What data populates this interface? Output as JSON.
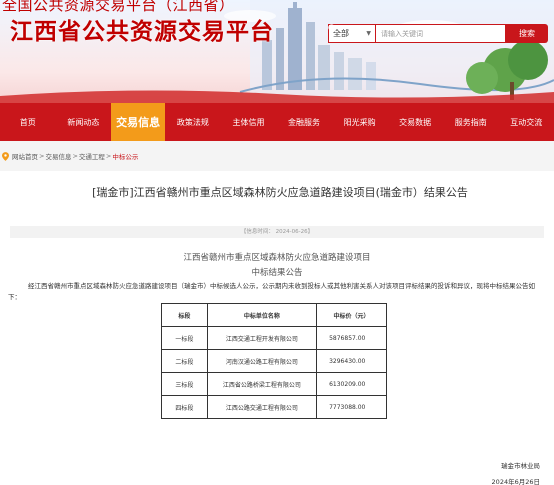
{
  "header": {
    "subtitle": "全国公共资源交易平台（江西省）",
    "title": "江西省公共资源交易平台"
  },
  "search": {
    "scope": "全部",
    "placeholder": "请输入关键词",
    "button": "搜索"
  },
  "nav": {
    "items": [
      "首页",
      "新闻动态",
      "交易信息",
      "政策法规",
      "主体信用",
      "金融服务",
      "阳光采购",
      "交易数据",
      "服务指南",
      "互动交流"
    ],
    "active_index": 2
  },
  "breadcrumb": {
    "items": [
      "网站首页",
      "交易信息",
      "交通工程",
      "中标公示"
    ],
    "separator": ">"
  },
  "article": {
    "title": "[瑞金市]江西省赣州市重点区域森林防火应急道路建设项目(瑞金市）结果公告",
    "date_label": "【信息时间： 2024-06-26】",
    "heading": "江西省赣州市重点区域森林防火应急道路建设项目",
    "subheading": "中标结果公告",
    "intro": "经江西省赣州市重点区域森林防火应急道路建设项目（瑞金市）中标候选人公示，公示期内未收到投标人或其他利害关系人对该项目评标结果的投诉和异议，现将中标结果公告如下："
  },
  "table": {
    "headers": [
      "标段",
      "中标单位名称",
      "中标价（元）"
    ],
    "rows": [
      [
        "一标段",
        "江西交通工程开发有限公司",
        "5876857.00"
      ],
      [
        "二标段",
        "河南汉通公路工程有限公司",
        "3296430.00"
      ],
      [
        "三标段",
        "江西省公路桥梁工程有限公司",
        "6130209.00"
      ],
      [
        "四标段",
        "江西公路交通工程有限公司",
        "7773088.00"
      ]
    ]
  },
  "footer": {
    "org": "瑞金市林业局",
    "date": "2024年6月26日"
  },
  "colors": {
    "brand_red": "#c9161b",
    "active_orange": "#f39b1a"
  }
}
